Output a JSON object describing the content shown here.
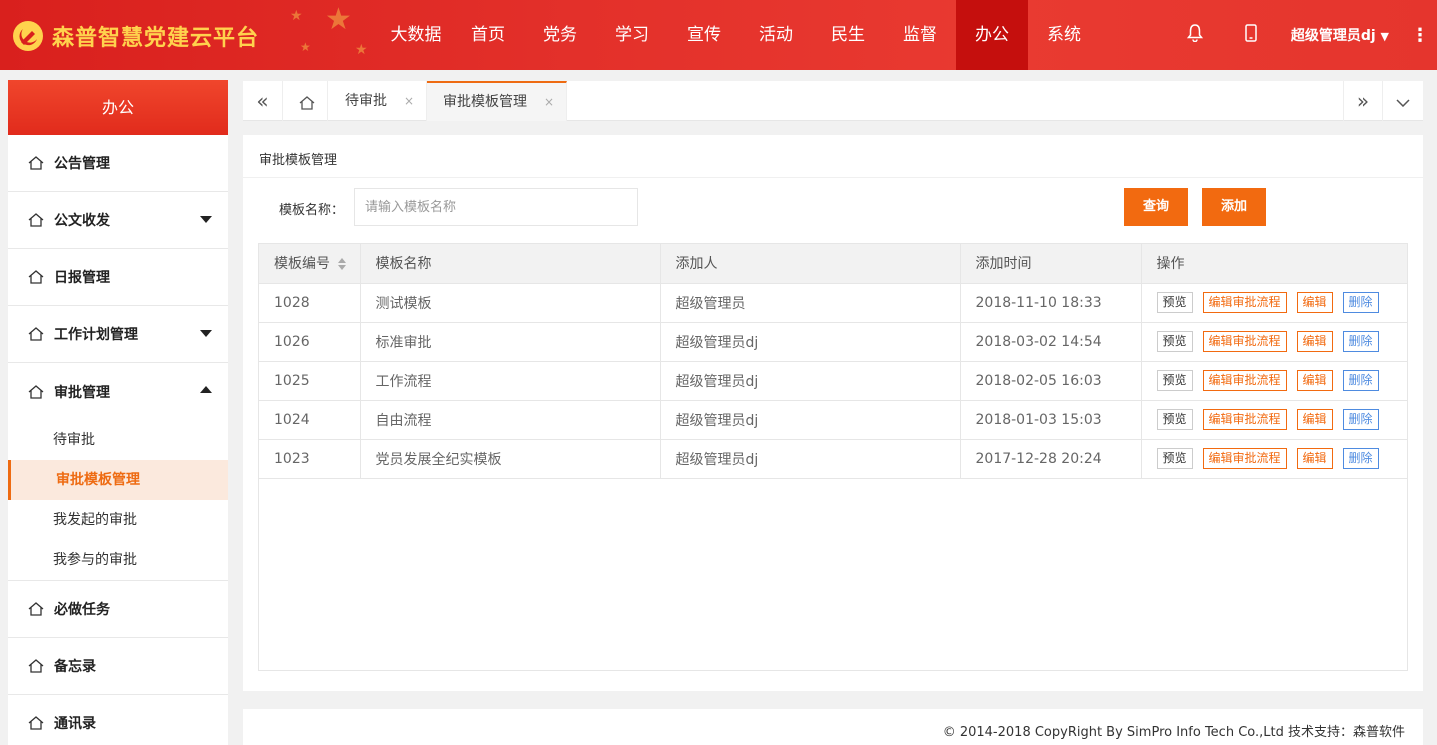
{
  "header": {
    "brand_title": "森普智慧党建云平台",
    "nav": [
      "大数据",
      "首页",
      "党务",
      "学习",
      "宣传",
      "活动",
      "民生",
      "监督",
      "办公",
      "系统"
    ],
    "active_nav_index": 8,
    "icons": [
      "bell-icon",
      "mobile-icon"
    ],
    "user": "超级管理员dj",
    "colors": {
      "bar": "#e3302a",
      "active": "#c50f0d",
      "brand_text": "#ffd24d"
    }
  },
  "sidebar": {
    "title": "办公",
    "items": [
      {
        "label": "公告管理",
        "arrow": "none"
      },
      {
        "label": "公文收发",
        "arrow": "down"
      },
      {
        "label": "日报管理",
        "arrow": "none"
      },
      {
        "label": "工作计划管理",
        "arrow": "down"
      },
      {
        "label": "审批管理",
        "arrow": "up"
      }
    ],
    "sub_items": [
      "待审批",
      "审批模板管理",
      "我发起的审批",
      "我参与的审批"
    ],
    "active_sub_index": 1,
    "after_items": [
      "必做任务",
      "备忘录",
      "通讯录"
    ]
  },
  "tabs": {
    "items": [
      {
        "label": "待审批",
        "close": "×"
      },
      {
        "label": "审批模板管理",
        "close": "×"
      }
    ],
    "active_index": 1
  },
  "main": {
    "panel_title": "审批模板管理",
    "search_label": "模板名称：",
    "search_placeholder": "请输入模板名称",
    "query_button": "查询",
    "add_button": "添加",
    "accent": "#f26a10"
  },
  "table": {
    "columns": [
      "模板编号",
      "模板名称",
      "添加人",
      "添加时间",
      "操作"
    ],
    "rows": [
      {
        "id": "1028",
        "name": "测试模板",
        "creator": "超级管理员",
        "time": "2018-11-10 18:33"
      },
      {
        "id": "1026",
        "name": "标准审批",
        "creator": "超级管理员dj",
        "time": "2018-03-02 14:54"
      },
      {
        "id": "1025",
        "name": "工作流程",
        "creator": "超级管理员dj",
        "time": "2018-02-05 16:03"
      },
      {
        "id": "1024",
        "name": "自由流程",
        "creator": "超级管理员dj",
        "time": "2018-01-03 15:03"
      },
      {
        "id": "1023",
        "name": "党员发展全纪实模板",
        "creator": "超级管理员dj",
        "time": "2017-12-28 20:24"
      }
    ],
    "actions": {
      "preview": "预览",
      "edit_flow": "编辑审批流程",
      "edit": "编辑",
      "delete": "删除"
    }
  },
  "footer": {
    "copyright": "© 2014-2018 CopyRight By SimPro Info Tech Co.,Ltd 技术支持：森普软件"
  }
}
